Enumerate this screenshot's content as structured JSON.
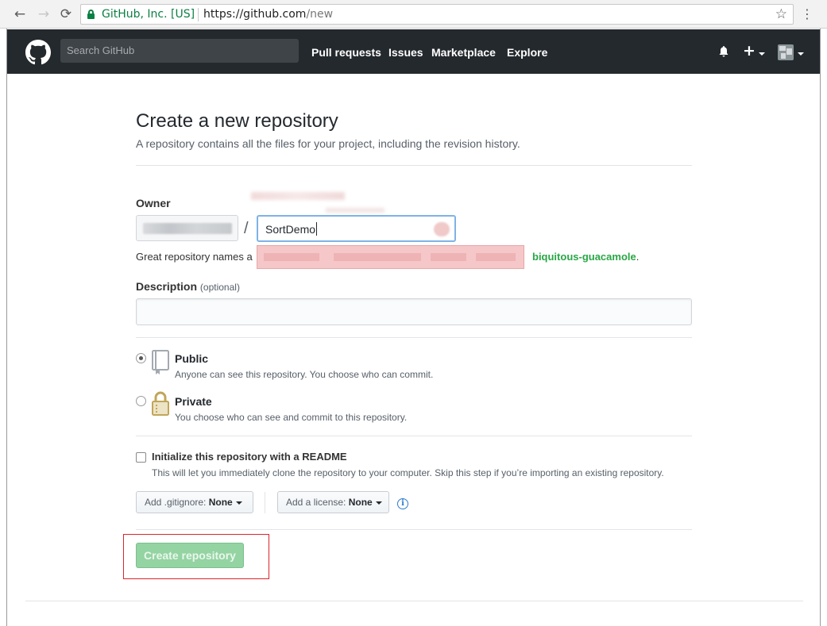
{
  "browser": {
    "site_identity": "GitHub, Inc. [US]",
    "url_base": "https://github.com",
    "url_path": "/new",
    "back_glyph": "←",
    "forward_glyph": "→",
    "reload_glyph": "⟳",
    "star_glyph": "☆",
    "menu_glyph": "⋮"
  },
  "header": {
    "search_placeholder": "Search GitHub",
    "nav": [
      "Pull requests",
      "Issues",
      "Marketplace",
      "Explore"
    ],
    "plus_glyph": "+"
  },
  "form": {
    "title": "Create a new repository",
    "subtitle": "A repository contains all the files for your project, including the revision history.",
    "owner_label": "Owner",
    "slash": "/",
    "repo_name_value": "SortDemo",
    "hint_prefix": "Great repository names a",
    "hint_suffix": "biquitous-guacamole",
    "hint_period": ".",
    "description_label": "Description",
    "description_optional": "(optional)",
    "description_value": "",
    "visibility": {
      "selected": "public",
      "public_title": "Public",
      "public_desc": "Anyone can see this repository. You choose who can commit.",
      "private_title": "Private",
      "private_desc": "You choose who can see and commit to this repository."
    },
    "readme": {
      "checked": false,
      "label": "Initialize this repository with a README",
      "desc": "This will let you immediately clone the repository to your computer. Skip this step if you’re importing an existing repository."
    },
    "gitignore_label": "Add .gitignore:",
    "gitignore_value": "None",
    "license_label": "Add a license:",
    "license_value": "None",
    "info_glyph": "i",
    "create_button": "Create repository"
  },
  "colors": {
    "header_bg": "#24292e",
    "create_button_bg": "#94d3a2",
    "highlight_border": "#d9262c",
    "success_green": "#28a745"
  },
  "icons": {
    "public": "repo-book-icon",
    "private": "lock-icon",
    "info": "info-icon",
    "bell": "bell-icon"
  }
}
